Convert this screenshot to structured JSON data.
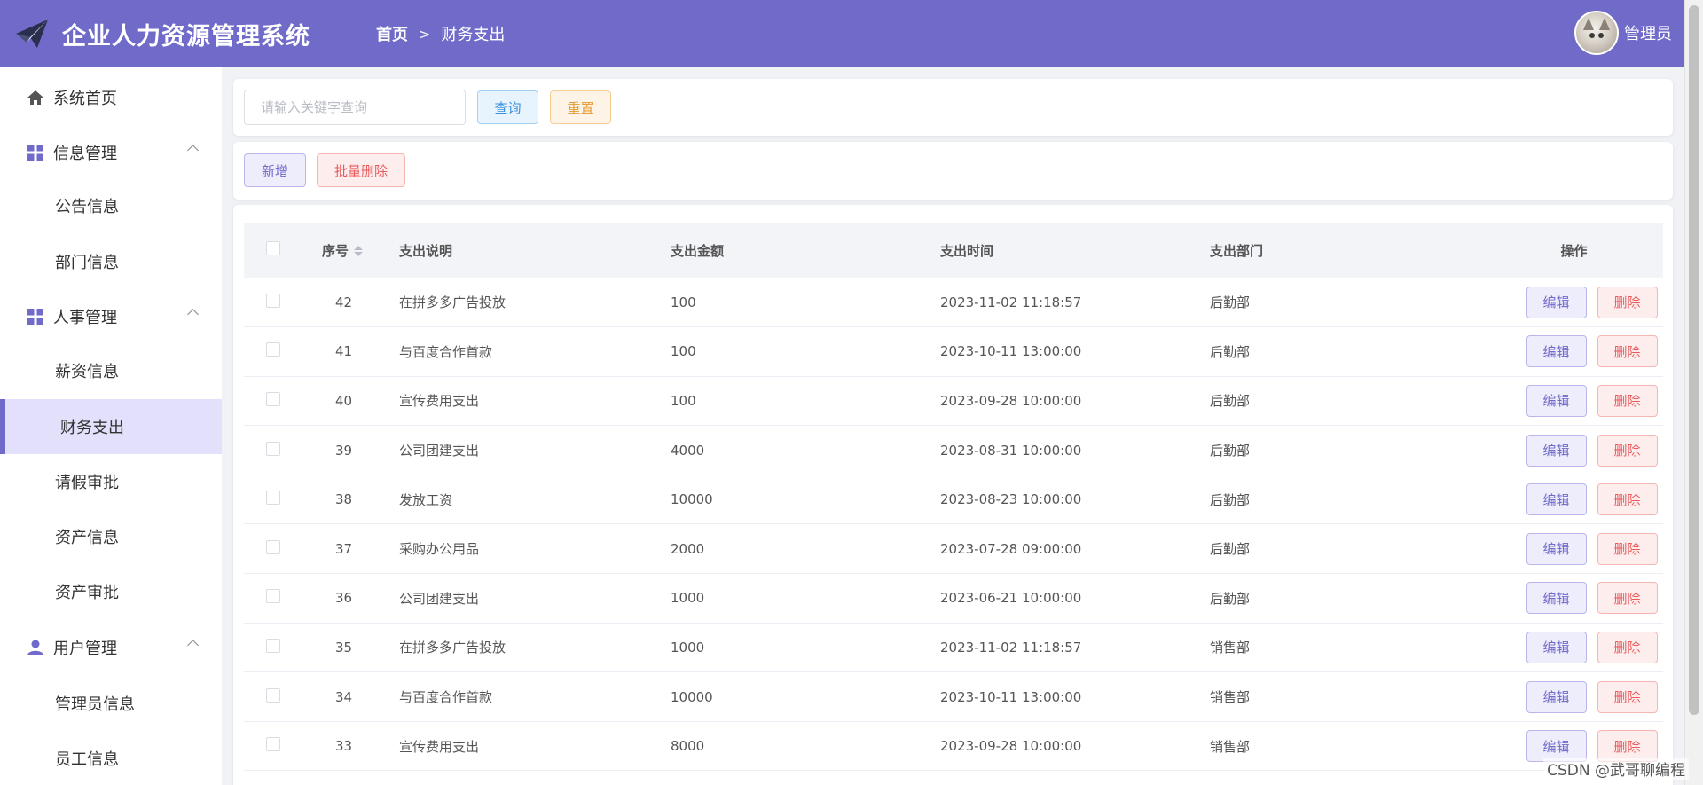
{
  "header": {
    "app_title": "企业人力资源管理系统",
    "breadcrumb": {
      "home": "首页",
      "current": "财务支出"
    },
    "user_name": "管理员"
  },
  "sidebar": {
    "items": [
      {
        "label": "系统首页",
        "icon": "home-icon"
      },
      {
        "label": "信息管理",
        "icon": "grid-icon",
        "children": [
          "公告信息",
          "部门信息"
        ]
      },
      {
        "label": "人事管理",
        "icon": "grid-icon",
        "children": [
          "薪资信息",
          "财务支出",
          "请假审批",
          "资产信息",
          "资产审批"
        ]
      },
      {
        "label": "用户管理",
        "icon": "user-icon",
        "children": [
          "管理员信息",
          "员工信息"
        ]
      }
    ],
    "active": "财务支出"
  },
  "search": {
    "placeholder": "请输入关键字查询",
    "value": "",
    "query_label": "查询",
    "reset_label": "重置"
  },
  "toolbar": {
    "add_label": "新增",
    "batch_delete_label": "批量删除"
  },
  "table": {
    "columns": [
      "序号",
      "支出说明",
      "支出金额",
      "支出时间",
      "支出部门",
      "操作"
    ],
    "edit_label": "编辑",
    "delete_label": "删除",
    "rows": [
      {
        "id": "42",
        "desc": "在拼多多广告投放",
        "amount": "100",
        "time": "2023-11-02 11:18:57",
        "dept": "后勤部"
      },
      {
        "id": "41",
        "desc": "与百度合作首款",
        "amount": "100",
        "time": "2023-10-11 13:00:00",
        "dept": "后勤部"
      },
      {
        "id": "40",
        "desc": "宣传费用支出",
        "amount": "100",
        "time": "2023-09-28 10:00:00",
        "dept": "后勤部"
      },
      {
        "id": "39",
        "desc": "公司团建支出",
        "amount": "4000",
        "time": "2023-08-31 10:00:00",
        "dept": "后勤部"
      },
      {
        "id": "38",
        "desc": "发放工资",
        "amount": "10000",
        "time": "2023-08-23 10:00:00",
        "dept": "后勤部"
      },
      {
        "id": "37",
        "desc": "采购办公用品",
        "amount": "2000",
        "time": "2023-07-28 09:00:00",
        "dept": "后勤部"
      },
      {
        "id": "36",
        "desc": "公司团建支出",
        "amount": "1000",
        "time": "2023-06-21 10:00:00",
        "dept": "后勤部"
      },
      {
        "id": "35",
        "desc": "在拼多多广告投放",
        "amount": "1000",
        "time": "2023-11-02 11:18:57",
        "dept": "销售部"
      },
      {
        "id": "34",
        "desc": "与百度合作首款",
        "amount": "10000",
        "time": "2023-10-11 13:00:00",
        "dept": "销售部"
      },
      {
        "id": "33",
        "desc": "宣传费用支出",
        "amount": "8000",
        "time": "2023-09-28 10:00:00",
        "dept": "销售部"
      }
    ]
  },
  "watermark": "CSDN @武哥聊编程",
  "colors": {
    "primary": "#706ac9",
    "active_bg": "#e2e0fb",
    "danger": "#e9595b",
    "info": "#3b8fdd",
    "warning": "#e69930"
  }
}
